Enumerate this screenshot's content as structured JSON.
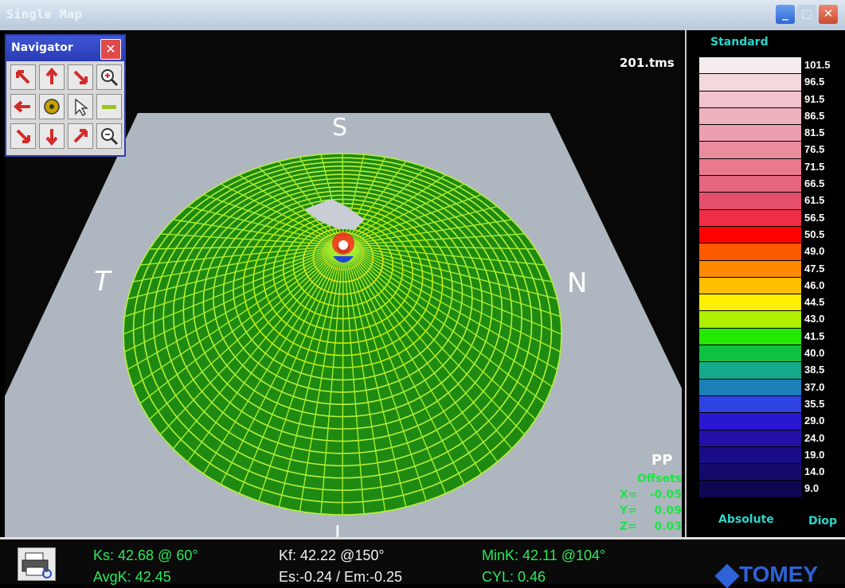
{
  "window": {
    "title": "Single Map",
    "min_label": "_",
    "max_label": "□",
    "close_label": "✕"
  },
  "navigator": {
    "title": "Navigator",
    "close_label": "✕",
    "buttons": [
      {
        "name": "rotate-up-left-icon",
        "color": "#d32a2a"
      },
      {
        "name": "arrow-up-icon",
        "color": "#d32a2a"
      },
      {
        "name": "rotate-down-right-icon",
        "color": "#d32a2a"
      },
      {
        "name": "zoom-in-icon",
        "color": "#333333"
      },
      {
        "name": "arrow-left-icon",
        "color": "#d32a2a"
      },
      {
        "name": "center-target-icon",
        "color": "#c9a200"
      },
      {
        "name": "pointer-icon",
        "color": "#444444"
      },
      {
        "name": "flat-view-icon",
        "color": "#9ac41f"
      },
      {
        "name": "arrow-down-left-icon",
        "color": "#d32a2a"
      },
      {
        "name": "arrow-down-icon",
        "color": "#d32a2a"
      },
      {
        "name": "arrow-up-right-icon",
        "color": "#d32a2a"
      },
      {
        "name": "zoom-out-icon",
        "color": "#333333"
      }
    ]
  },
  "map": {
    "filename": "201.tms",
    "directions": {
      "top": "S",
      "left": "T",
      "right": "N",
      "bottom": "I"
    },
    "pp": "PP",
    "offsets": {
      "title": "Offsets",
      "x_label": "X=",
      "x": "-0.05",
      "y_label": "Y=",
      "y": "0.09",
      "z_label": "Z=",
      "z": "0.03"
    }
  },
  "legend": {
    "scale_name": "Standard",
    "mode": "Absolute",
    "unit": "Diop",
    "steps": [
      {
        "value": "101.5",
        "color": "#f4ecec"
      },
      {
        "value": "96.5",
        "color": "#f3d8dc"
      },
      {
        "value": "91.5",
        "color": "#f0c4cc"
      },
      {
        "value": "86.5",
        "color": "#eeb2bd"
      },
      {
        "value": "81.5",
        "color": "#ec9fae"
      },
      {
        "value": "76.5",
        "color": "#ea8c9e"
      },
      {
        "value": "71.5",
        "color": "#e8798f"
      },
      {
        "value": "66.5",
        "color": "#e6667f"
      },
      {
        "value": "61.5",
        "color": "#e44f6c"
      },
      {
        "value": "56.5",
        "color": "#ef2d45"
      },
      {
        "value": "50.5",
        "color": "#ff0000"
      },
      {
        "value": "49.0",
        "color": "#ff5a00"
      },
      {
        "value": "47.5",
        "color": "#ff8a00"
      },
      {
        "value": "46.0",
        "color": "#ffbf00"
      },
      {
        "value": "44.5",
        "color": "#fff000"
      },
      {
        "value": "43.0",
        "color": "#aef000"
      },
      {
        "value": "41.5",
        "color": "#23e800"
      },
      {
        "value": "40.0",
        "color": "#10c040"
      },
      {
        "value": "38.5",
        "color": "#16a88a"
      },
      {
        "value": "37.0",
        "color": "#1c7fb8"
      },
      {
        "value": "35.5",
        "color": "#2f44e0"
      },
      {
        "value": "29.0",
        "color": "#2a18d0"
      },
      {
        "value": "24.0",
        "color": "#2410a8"
      },
      {
        "value": "19.0",
        "color": "#1a0c88"
      },
      {
        "value": "14.0",
        "color": "#140a6a"
      },
      {
        "value": "9.0",
        "color": "#0e0850"
      }
    ]
  },
  "stats": {
    "ks": "Ks: 42.68 @ 60°",
    "kf": "Kf: 42.22 @150°",
    "mink": "MinK: 42.11 @104°",
    "avgk": "AvgK: 42.45",
    "es_em": "Es:-0.24 / Em:-0.25",
    "cyl": "CYL: 0.46"
  },
  "brand": "TOMEY"
}
